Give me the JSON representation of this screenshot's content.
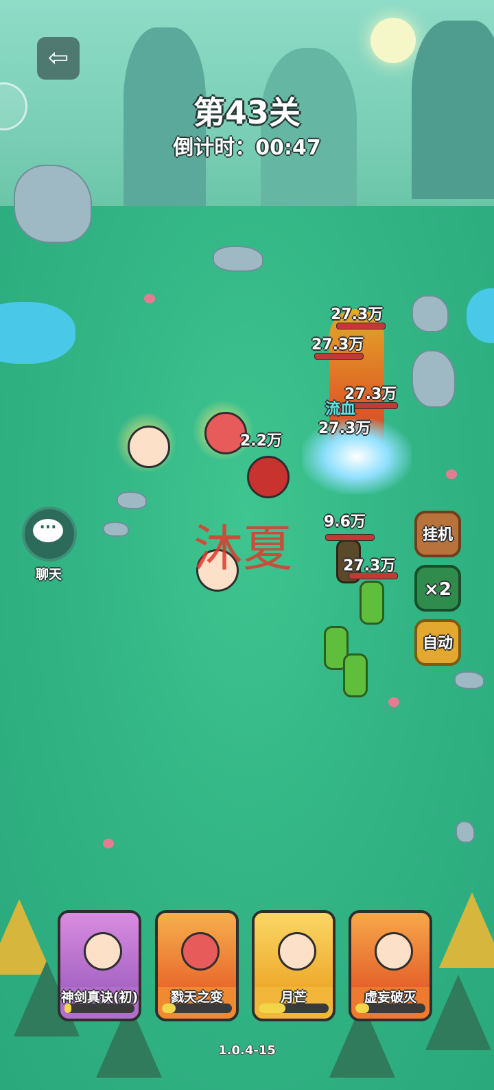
{
  "level": {
    "title": "第43关",
    "countdown_label": "倒计时：",
    "countdown_value": "00:47"
  },
  "chat": {
    "label": "聊天",
    "icon": "chat-bubble-icon",
    "glyph": "···"
  },
  "exit": {
    "glyph": "⇦",
    "icon": "exit-icon"
  },
  "controls": {
    "idle_label": "挂机",
    "speed_label": "×2",
    "auto_label": "自动"
  },
  "watermark": "沐夏",
  "damage_numbers": [
    "27.3万",
    "27.3万",
    "27.3万",
    "27.3万",
    "2.2万",
    "9.6万",
    "27.3万"
  ],
  "status_effect": "流血",
  "skills": [
    {
      "name": "神剑真诀(初)",
      "progress": 0.1
    },
    {
      "name": "戮天之变",
      "progress": 0.2
    },
    {
      "name": "月芒",
      "progress": 0.38
    },
    {
      "name": "虚妄破灭",
      "progress": 0.2
    }
  ],
  "version": "1.0.4-15"
}
